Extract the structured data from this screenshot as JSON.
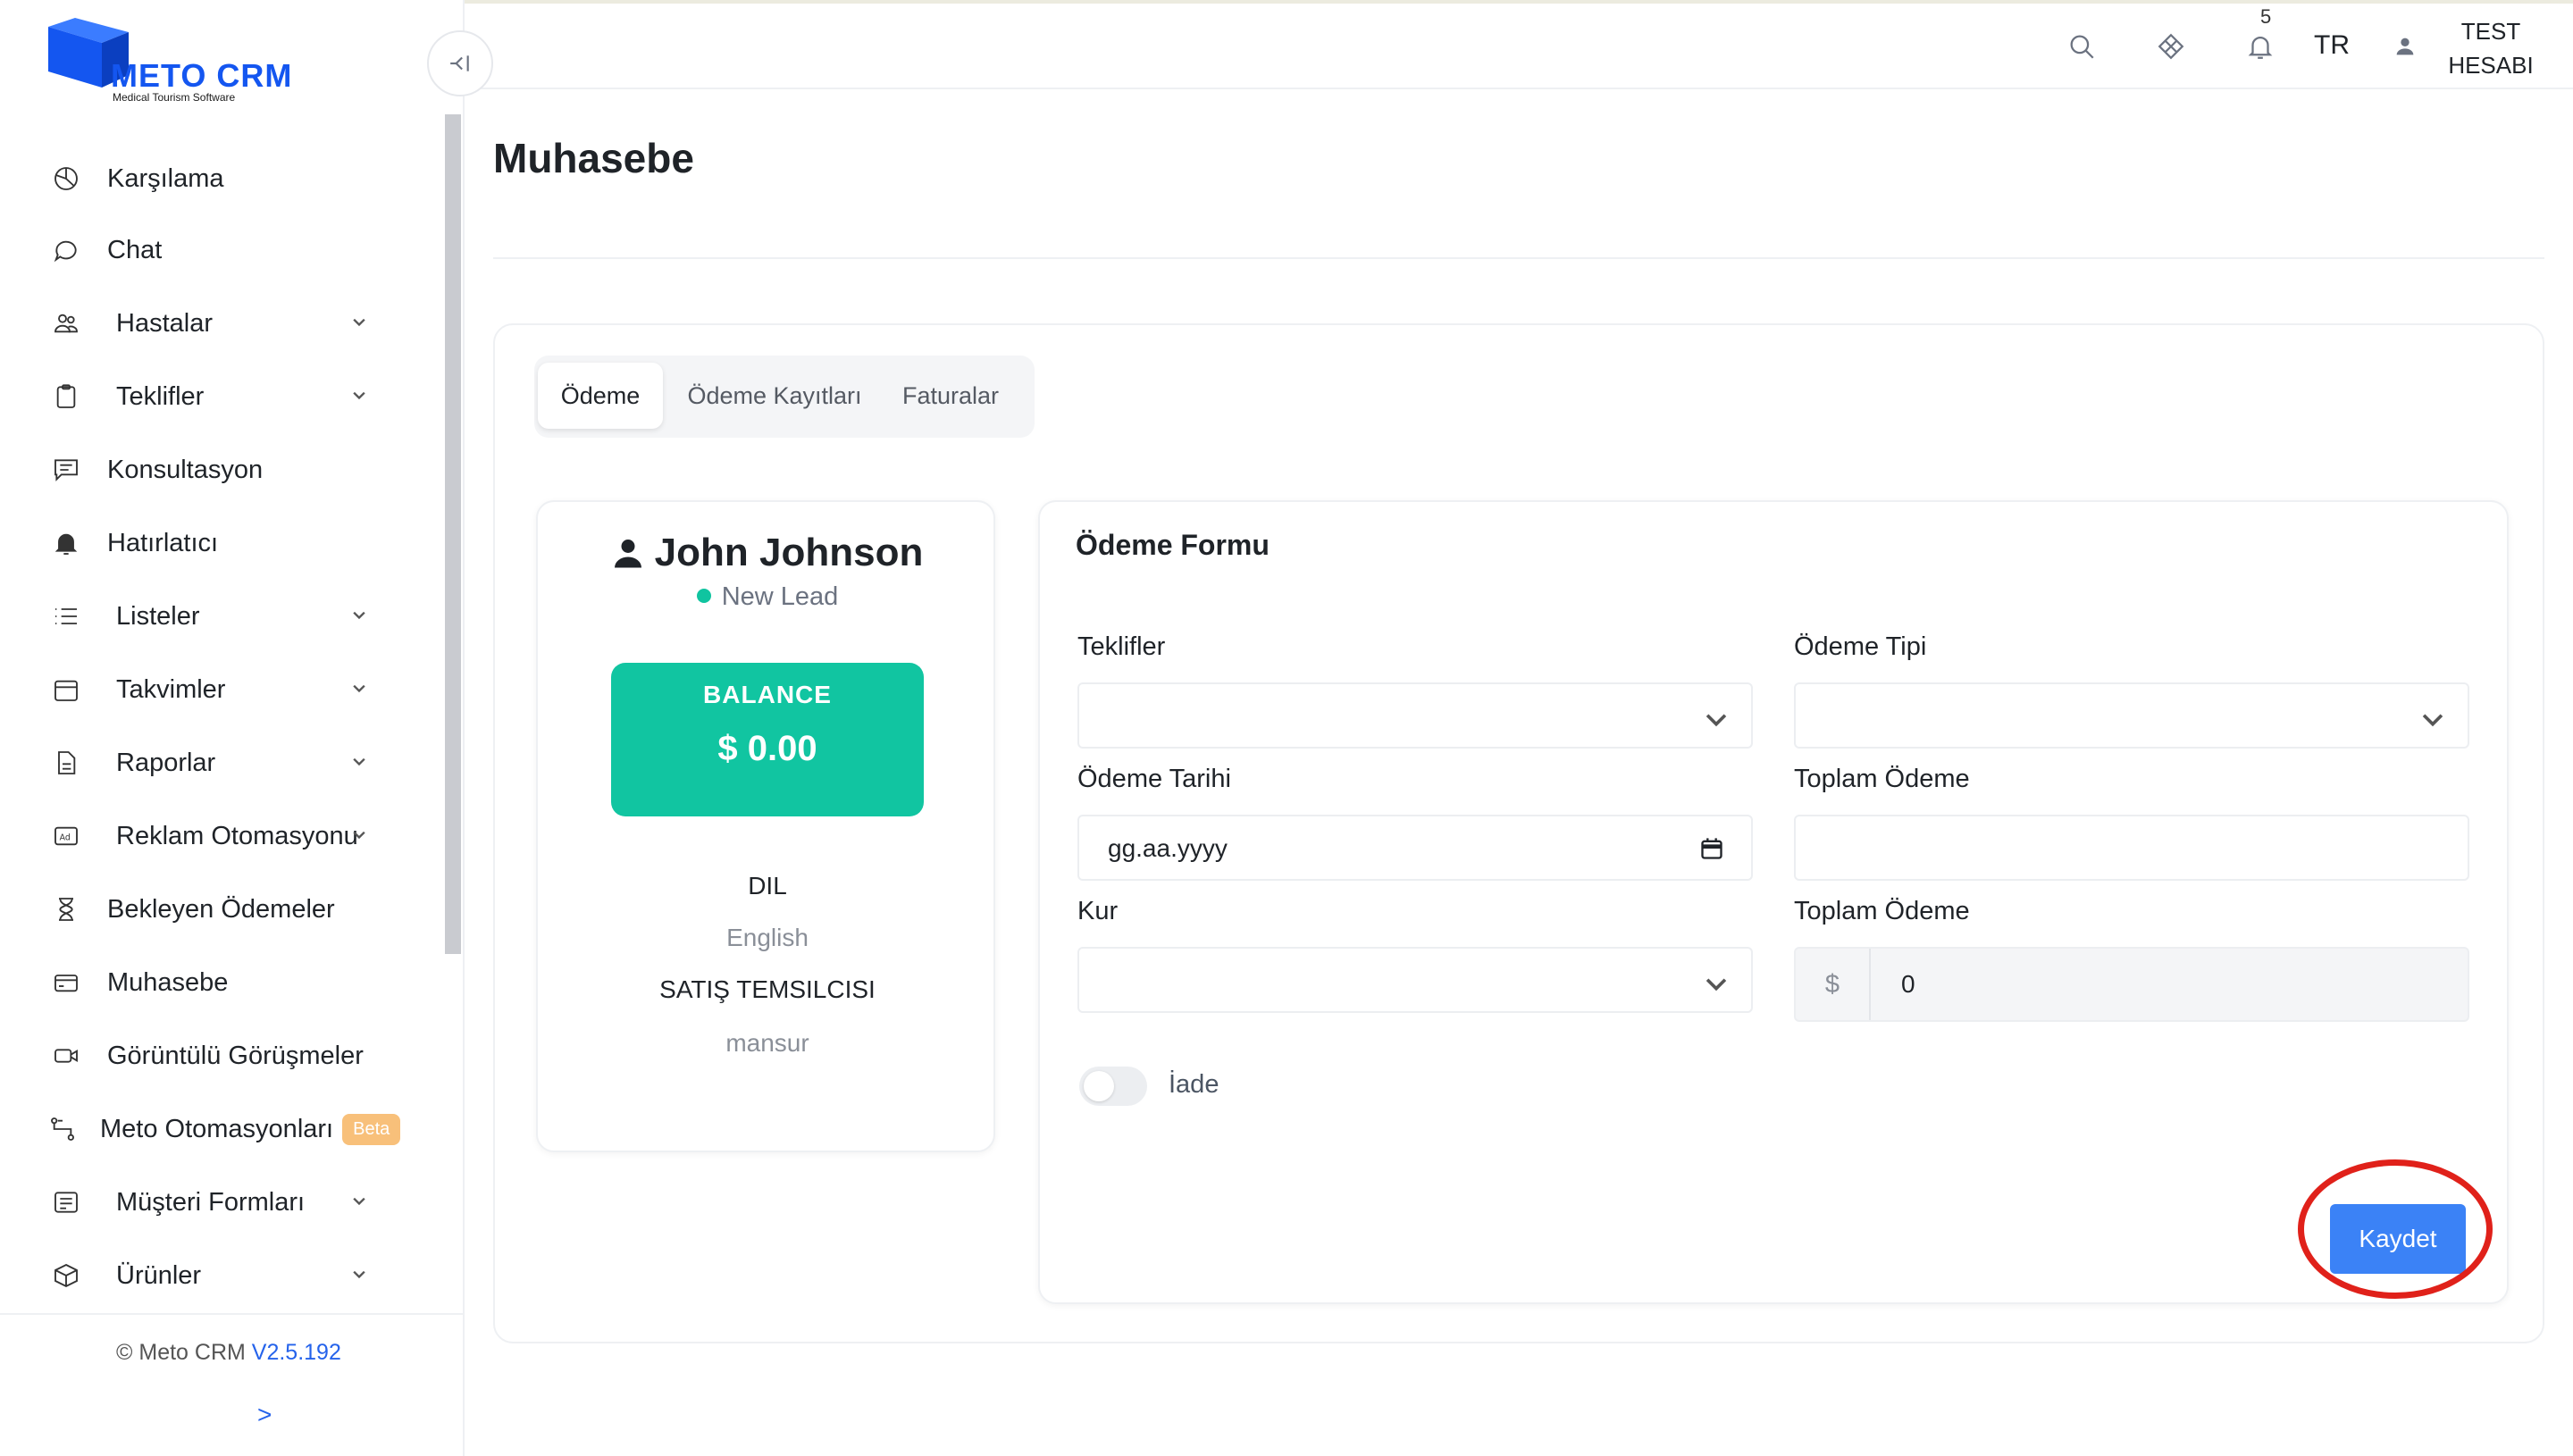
{
  "brand": {
    "title": "METO CRM",
    "subtitle": "Medical Tourism Software",
    "color": "#1456f0"
  },
  "sidebar": {
    "collapse_icon": "collapse-left-icon",
    "items": [
      {
        "label": "Karşılama",
        "icon": "dashboard-icon",
        "has_children": false
      },
      {
        "label": "Chat",
        "icon": "chat-bubble-icon",
        "has_children": false
      },
      {
        "label": "Hastalar",
        "icon": "users-icon",
        "has_children": true
      },
      {
        "label": "Teklifler",
        "icon": "clipboard-icon",
        "has_children": true
      },
      {
        "label": "Konsultasyon",
        "icon": "message-square-icon",
        "has_children": false
      },
      {
        "label": "Hatırlatıcı",
        "icon": "bell-icon",
        "has_children": false
      },
      {
        "label": "Listeler",
        "icon": "list-icon",
        "has_children": true
      },
      {
        "label": "Takvimler",
        "icon": "calendar-icon",
        "has_children": true
      },
      {
        "label": "Raporlar",
        "icon": "document-icon",
        "has_children": true
      },
      {
        "label": "Reklam Otomasyonu",
        "icon": "ad-icon",
        "has_children": true
      },
      {
        "label": "Bekleyen Ödemeler",
        "icon": "hourglass-icon",
        "has_children": false
      },
      {
        "label": "Muhasebe",
        "icon": "credit-card-icon",
        "has_children": false
      },
      {
        "label": "Görüntülü Görüşmeler",
        "icon": "video-icon",
        "has_children": false
      },
      {
        "label": "Meto Otomasyonları",
        "icon": "flow-icon",
        "has_children": false,
        "badge": "Beta"
      },
      {
        "label": "Müşteri Formları",
        "icon": "form-icon",
        "has_children": true
      },
      {
        "label": "Ürünler",
        "icon": "box-icon",
        "has_children": true
      }
    ],
    "footer": {
      "copyright": "© Meto CRM",
      "version": "V2.5.192",
      "expand": ">"
    }
  },
  "header": {
    "notification_count": "5",
    "language": "TR",
    "user_name": "TEST HESABI"
  },
  "page": {
    "title": "Muhasebe"
  },
  "tabs": [
    {
      "label": "Ödeme",
      "active": true
    },
    {
      "label": "Ödeme Kayıtları",
      "active": false
    },
    {
      "label": "Faturalar",
      "active": false
    }
  ],
  "profile": {
    "name": "John Johnson",
    "status": "New Lead",
    "status_color": "#10c4a0",
    "balance_label": "BALANCE",
    "balance_value": "$ 0.00",
    "balance_color": "#11c5a1",
    "language_label": "DIL",
    "language_value": "English",
    "rep_label": "SATIŞ TEMSILCISI",
    "rep_value": "mansur"
  },
  "form": {
    "title": "Ödeme Formu",
    "teklifler_label": "Teklifler",
    "teklifler_value": "",
    "odeme_tipi_label": "Ödeme Tipi",
    "odeme_tipi_value": "",
    "odeme_tarihi_label": "Ödeme Tarihi",
    "odeme_tarihi_placeholder": "gg.aa.yyyy",
    "toplam_odeme_label": "Toplam Ödeme",
    "toplam_odeme_value": "",
    "kur_label": "Kur",
    "kur_value": "",
    "toplam_odeme2_label": "Toplam Ödeme",
    "currency_prefix": "$",
    "toplam_odeme2_value": "0",
    "iade_label": "İade",
    "iade_checked": false,
    "save_label": "Kaydet",
    "save_color": "#3b82f6",
    "highlight_color": "#e0211a"
  }
}
